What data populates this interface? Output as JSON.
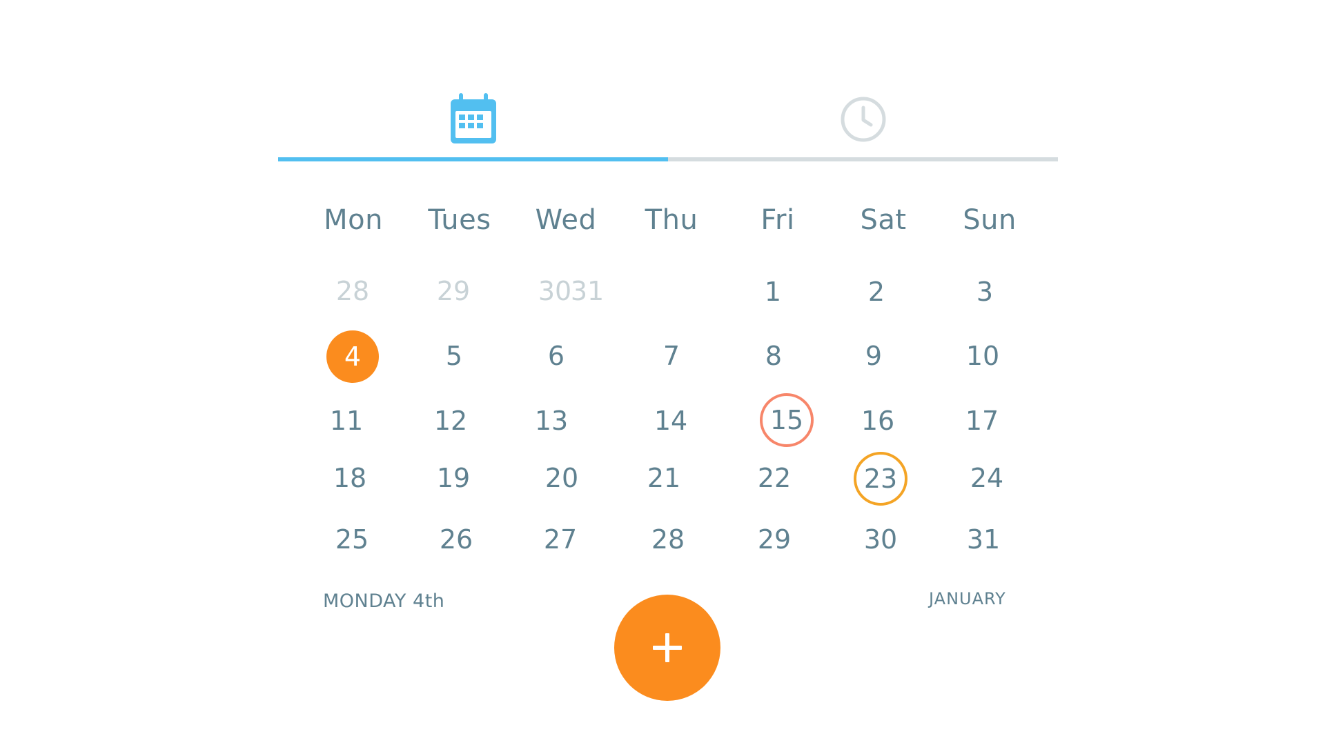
{
  "tabs": [
    {
      "name": "calendar",
      "icon": "calendar-icon",
      "active": true
    },
    {
      "name": "clock",
      "icon": "clock-icon",
      "active": false
    }
  ],
  "colors": {
    "accent": "#52bff0",
    "primary_orange": "#fb8c1e",
    "ring_red": "#f7866a",
    "ring_orange": "#f4a425",
    "text": "#5f8190",
    "muted_text": "#c8d2d6"
  },
  "weekdays": [
    "Mon",
    "Tues",
    "Wed",
    "Thu",
    "Fri",
    "Sat",
    "Sun"
  ],
  "days": {
    "prev_month": [
      "28",
      "29",
      "30",
      "31"
    ],
    "current": [
      "1",
      "2",
      "3",
      "4",
      "5",
      "6",
      "7",
      "8",
      "9",
      "10",
      "11",
      "12",
      "13",
      "14",
      "15",
      "16",
      "17",
      "18",
      "19",
      "20",
      "21",
      "22",
      "23",
      "24",
      "25",
      "26",
      "27",
      "28",
      "29",
      "30",
      "31"
    ]
  },
  "highlights": {
    "today": "4",
    "ring_red": "15",
    "ring_orange": "23"
  },
  "footer": {
    "selected_date": "MONDAY 4th",
    "month": "JANUARY"
  },
  "fab": {
    "icon": "plus-icon"
  }
}
